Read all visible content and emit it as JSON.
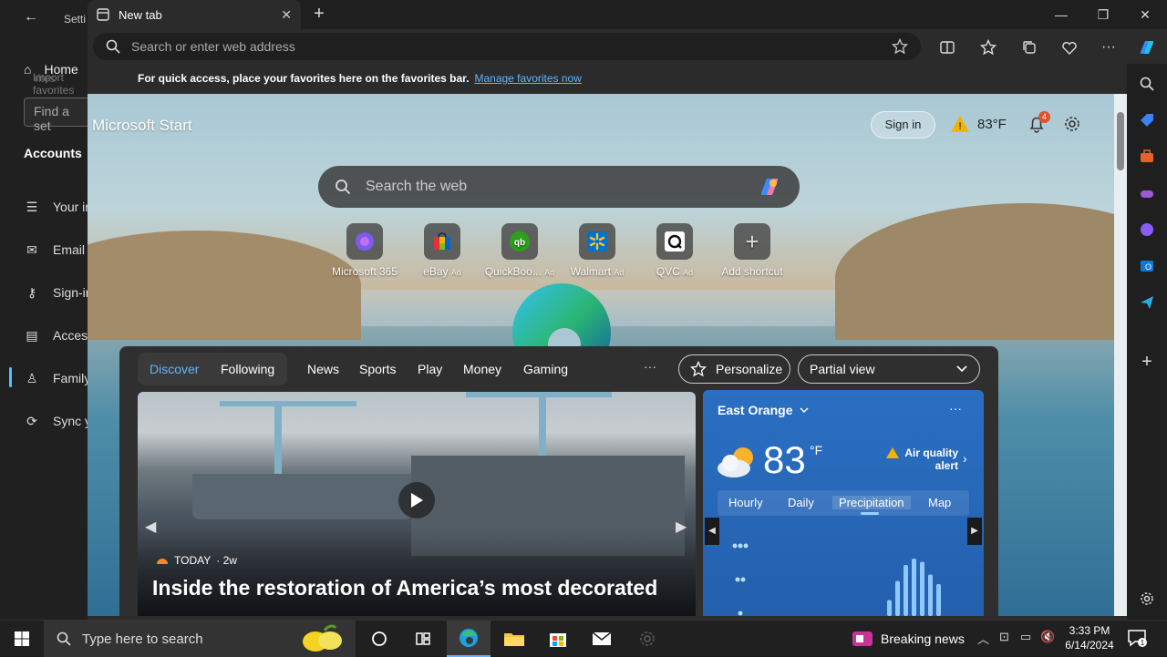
{
  "settings_window": {
    "title": "Setti",
    "home": "Home",
    "import_ghost": "Import favorites",
    "find_placeholder": "Find a set",
    "section": "Accounts",
    "items": [
      "Your in",
      "Email &",
      "Sign-in",
      "Access",
      "Family",
      "Sync y"
    ]
  },
  "browser": {
    "tab_title": "New tab",
    "address_placeholder": "Search or enter web address",
    "favorites_message": "For quick access, place your favorites here on the favorites bar.",
    "favorites_link": "Manage favorites now"
  },
  "start_page": {
    "brand": "Microsoft Start",
    "sign_in": "Sign in",
    "weather_temp": "83°F",
    "notification_count": "4",
    "search_placeholder": "Search the web",
    "shortcuts": [
      {
        "label": "Microsoft 365",
        "ad": ""
      },
      {
        "label": "eBay",
        "ad": "Ad"
      },
      {
        "label": "QuickBoo...",
        "ad": "Ad"
      },
      {
        "label": "Walmart",
        "ad": "Ad"
      },
      {
        "label": "QVC",
        "ad": "Ad"
      },
      {
        "label": "Add shortcut",
        "ad": ""
      }
    ]
  },
  "feed": {
    "tabs": [
      "Discover",
      "Following",
      "News",
      "Sports",
      "Play",
      "Money",
      "Gaming"
    ],
    "more": "···",
    "personalize": "Personalize",
    "view": "Partial view",
    "hero": {
      "source": "TODAY",
      "age": "· 2w",
      "headline": "Inside the restoration of America’s most decorated"
    },
    "weather": {
      "location": "East Orange",
      "temp": "83",
      "unit": "°F",
      "alert": "Air quality alert",
      "tabs": [
        "Hourly",
        "Daily",
        "Precipitation",
        "Map"
      ],
      "selected_tab": "Precipitation",
      "precip_levels": [
        0.25,
        0.55,
        0.8,
        0.9,
        0.85,
        0.65,
        0.5
      ]
    }
  },
  "taskbar": {
    "search_placeholder": "Type here to search",
    "news": "Breaking news",
    "time": "3:33 PM",
    "date": "6/14/2024",
    "notif_count": "1"
  }
}
